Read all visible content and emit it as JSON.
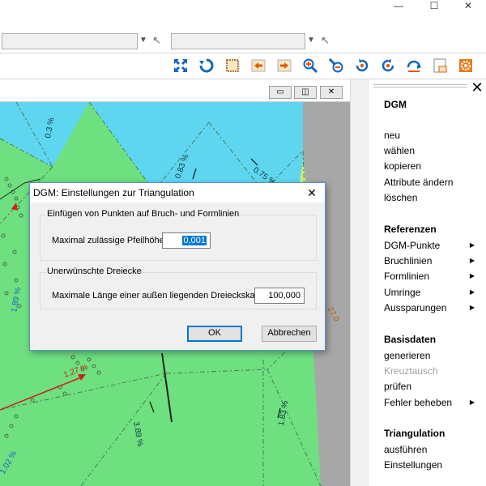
{
  "window_controls": {
    "minimize": "—",
    "maximize": "☐",
    "close": "✕"
  },
  "toolbar": {
    "icons": [
      "zoom-extents-icon",
      "refresh-icon",
      "select-area-icon",
      "arrow-left-icon",
      "arrow-right-icon",
      "zoom-in-icon",
      "zoom-out-icon",
      "rotate-left-icon",
      "rotate-right-icon",
      "undo-redraw-icon",
      "window-icon",
      "settings-gear-icon"
    ]
  },
  "mdi": {
    "minimize": "▭",
    "restore": "◫",
    "close": "✕"
  },
  "map": {
    "labels": [
      "0.3 %",
      "0.83 %",
      "0.75 %",
      "1.89 %",
      "3.89 %",
      "1.83 %",
      "1.02 %",
      "1.27 %",
      "27.0"
    ],
    "colors": {
      "green": "#6ee07f",
      "cyan": "#5ed6f0",
      "gray": "#a7a7a7",
      "yellowgreen": "#c8ee78"
    }
  },
  "panel": {
    "close": "✕",
    "sections": [
      {
        "title": "DGM",
        "items": [
          {
            "label": "neu"
          },
          {
            "label": "wählen"
          },
          {
            "label": "kopieren"
          },
          {
            "label": "Attribute ändern"
          },
          {
            "label": "löschen"
          }
        ]
      },
      {
        "title": "Referenzen",
        "items": [
          {
            "label": "DGM-Punkte",
            "arrow": "▶"
          },
          {
            "label": "Bruchlinien",
            "arrow": "▶"
          },
          {
            "label": "Formlinien",
            "arrow": "▶"
          },
          {
            "label": "Umringe",
            "arrow": "▶"
          },
          {
            "label": "Aussparungen",
            "arrow": "▶"
          }
        ]
      },
      {
        "title": "Basisdaten",
        "items": [
          {
            "label": "generieren"
          },
          {
            "label": "Kreuztausch",
            "disabled": true
          },
          {
            "label": "prüfen"
          },
          {
            "label": "Fehler beheben",
            "arrow": "▶"
          }
        ]
      },
      {
        "title": "Triangulation",
        "items": [
          {
            "label": "ausführen"
          },
          {
            "label": "Einstellungen"
          }
        ]
      }
    ]
  },
  "dialog": {
    "title": "DGM:  Einstellungen zur Triangulation",
    "close": "✕",
    "group1_label": "Einfügen von Punkten auf Bruch- und Formlinien",
    "field1_label": "Maximal zulässige Pfeilhöhe:",
    "field1_value": "0,001",
    "group2_label": "Unerwünschte Dreiecke",
    "field2_label": "Maximale Länge einer außen liegenden Dreieckskante:",
    "field2_value": "100,000",
    "ok_label": "OK",
    "cancel_label": "Abbrechen"
  }
}
